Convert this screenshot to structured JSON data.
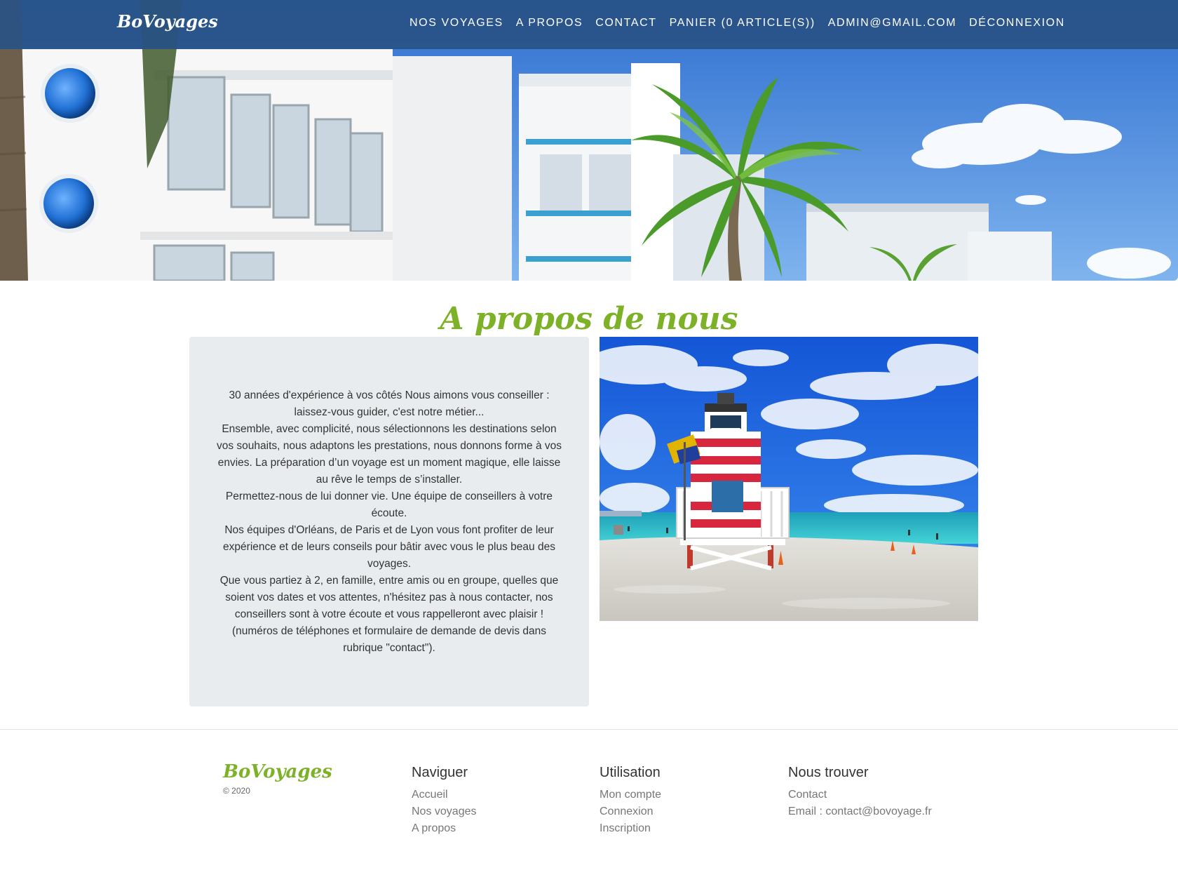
{
  "header": {
    "brand": "BoVoyages",
    "nav": [
      {
        "label": "NOS VOYAGES"
      },
      {
        "label": "A PROPOS"
      },
      {
        "label": "CONTACT"
      },
      {
        "label": "PANIER (0 ARTICLE(S))"
      },
      {
        "label": "ADMIN@GMAIL.COM"
      },
      {
        "label": "DÉCONNEXION"
      }
    ]
  },
  "hero": {
    "icon": "hero-photo-art-deco-hotel-palm"
  },
  "about": {
    "title": "A propos de nous",
    "paragraphs": [
      "30 années d'expérience à vos côtés Nous aimons vous conseiller : laissez-vous guider, c'est notre métier...",
      "Ensemble, avec complicité, nous sélectionnons les destinations selon vos souhaits, nous adaptons les prestations, nous donnons forme à vos envies. La préparation d’un voyage est un moment magique, elle laisse au rêve le temps de s’installer.",
      "Permettez-nous de lui donner vie. Une équipe de conseillers à votre écoute.",
      "Nos équipes d'Orléans, de Paris et de Lyon vous font profiter de leur expérience et de leurs conseils pour bâtir avec vous le plus beau des voyages.",
      "Que vous partiez à 2, en famille, entre amis ou en groupe, quelles que soient vos dates et vos attentes, n'hésitez pas à nous contacter, nos conseillers sont à votre écoute et vous rappelleront avec plaisir ! (numéros de téléphones et formulaire de demande de devis dans rubrique \"contact\")."
    ],
    "photo_icon": "lifeguard-tower-beach-photo"
  },
  "footer": {
    "brand": "BoVoyages",
    "copyright": "© 2020",
    "columns": [
      {
        "title": "Naviguer",
        "links": [
          "Accueil",
          "Nos voyages",
          "A propos"
        ]
      },
      {
        "title": "Utilisation",
        "links": [
          "Mon compte",
          "Connexion",
          "Inscription"
        ]
      },
      {
        "title": "Nous trouver",
        "links": [
          "Contact",
          "Email : contact@bovoyage.fr"
        ]
      }
    ]
  },
  "colors": {
    "navbar": "#285286",
    "accent_green": "#7cb128",
    "panel_gray": "#e9ecef"
  }
}
